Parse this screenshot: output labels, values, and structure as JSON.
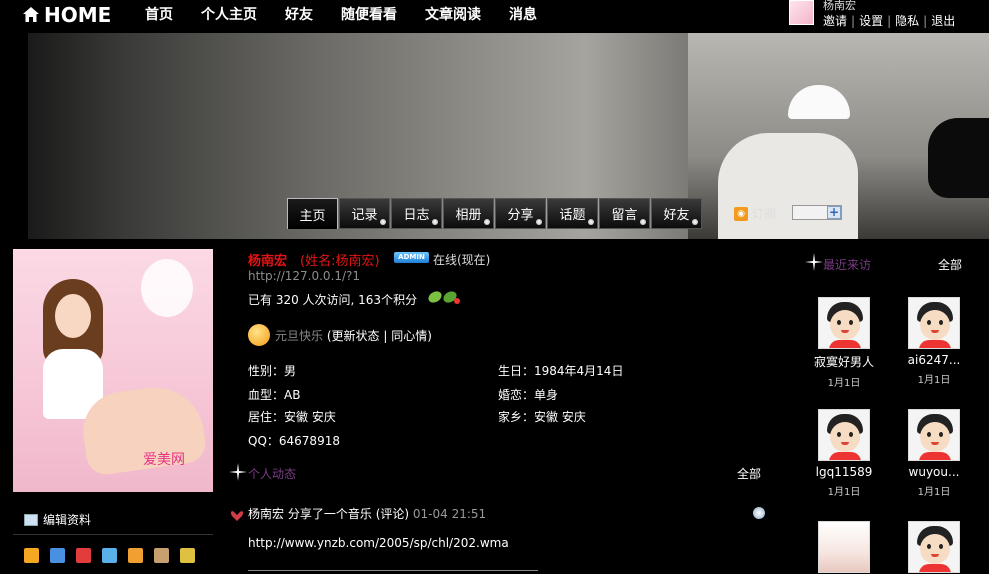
{
  "topnav": {
    "home_label": "HOME",
    "items": [
      "首页",
      "个人主页",
      "好友",
      "随便看看",
      "文章阅读",
      "消息"
    ]
  },
  "user_menu": {
    "name": "杨南宏",
    "links": [
      "邀请",
      "设置",
      "隐私",
      "退出"
    ]
  },
  "profile_tabs": {
    "items": [
      "主页",
      "记录",
      "日志",
      "相册",
      "分享",
      "话题",
      "留言",
      "好友"
    ],
    "active": "主页",
    "subscribe_label": "订阅"
  },
  "profile": {
    "name": "杨南宏",
    "realname": "(姓名:杨南宏)",
    "badge": "ADMIN",
    "online_status": "在线(现在)",
    "url": "http://127.0.0.1/?1",
    "visits_text": "已有  320 人次访问, 163个积分",
    "mood_text": "元旦快乐",
    "update_status": "(更新状态",
    "same_mood": "同心情)",
    "gender": "性别：男",
    "blood": "血型：AB",
    "residence": "居住：安徽 安庆",
    "qq": "QQ：64678918",
    "birthday": "生日：1984年4月14日",
    "marriage": "婚恋：单身",
    "hometown": "家乡：安徽 安庆",
    "photo_watermark": "爱美网"
  },
  "sidebar": {
    "edit_label": "编辑资料",
    "icon_colors": [
      "#f5a623",
      "#4a90e2",
      "#e23c3c",
      "#5ab0e8",
      "#f0a030",
      "#c8a070",
      "#e0c040"
    ]
  },
  "activity": {
    "title": "个人动态",
    "all_label": "全部",
    "feed": {
      "actor": "杨南宏",
      "action": "分享了一个音乐",
      "comment": "(评论)",
      "time": "01-04 21:51",
      "url": "http://www.ynzb.com/2005/sp/chl/202.wma"
    }
  },
  "visitors": {
    "title": "最近来访",
    "all_label": "全部",
    "items": [
      {
        "name": "寂寞好男人",
        "date": "1月1日"
      },
      {
        "name": "ai6247...",
        "date": "1月1日"
      },
      {
        "name": "lgq11589",
        "date": "1月1日"
      },
      {
        "name": "wuyou...",
        "date": "1月1日"
      },
      {
        "name": "",
        "date": ""
      },
      {
        "name": "",
        "date": ""
      }
    ]
  }
}
